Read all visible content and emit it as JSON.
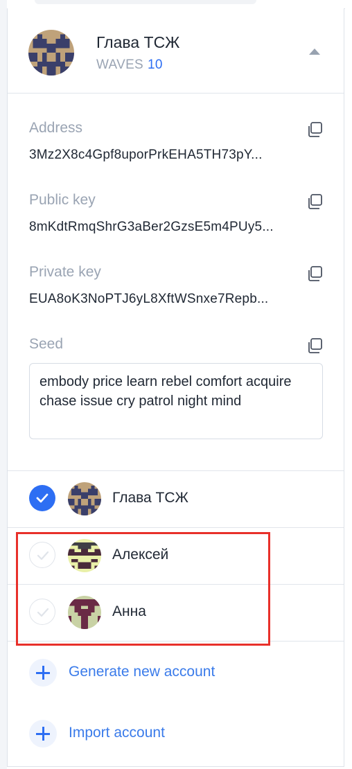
{
  "header": {
    "account_name": "Глава ТСЖ",
    "balance_asset": "WAVES",
    "balance_value": "10"
  },
  "fields": {
    "address": {
      "label": "Address",
      "value": "3Mz2X8c4Gpf8uporPrkEHA5TH73pY..."
    },
    "public_key": {
      "label": "Public key",
      "value": "8mKdtRmqShrG3aBer2GzsE5m4PUy5..."
    },
    "private_key": {
      "label": "Private key",
      "value": "EUA8oK3NoPTJ6yL8XftWSnxe7Repb..."
    },
    "seed": {
      "label": "Seed",
      "value": "embody price learn rebel comfort acquire chase issue cry patrol night mind"
    }
  },
  "accounts": [
    {
      "name": "Глава ТСЖ",
      "selected": true
    },
    {
      "name": "Алексей",
      "selected": false
    },
    {
      "name": "Анна",
      "selected": false
    }
  ],
  "actions": {
    "generate": "Generate new account",
    "import": "Import account"
  },
  "colors": {
    "accent": "#2d6ef3",
    "highlight_border": "#e8302a",
    "muted_text": "#9aa4b3"
  },
  "icons": {
    "copy": "copy-icon",
    "check": "check-icon",
    "collapse": "chevron-up-icon",
    "add": "plus-icon"
  }
}
